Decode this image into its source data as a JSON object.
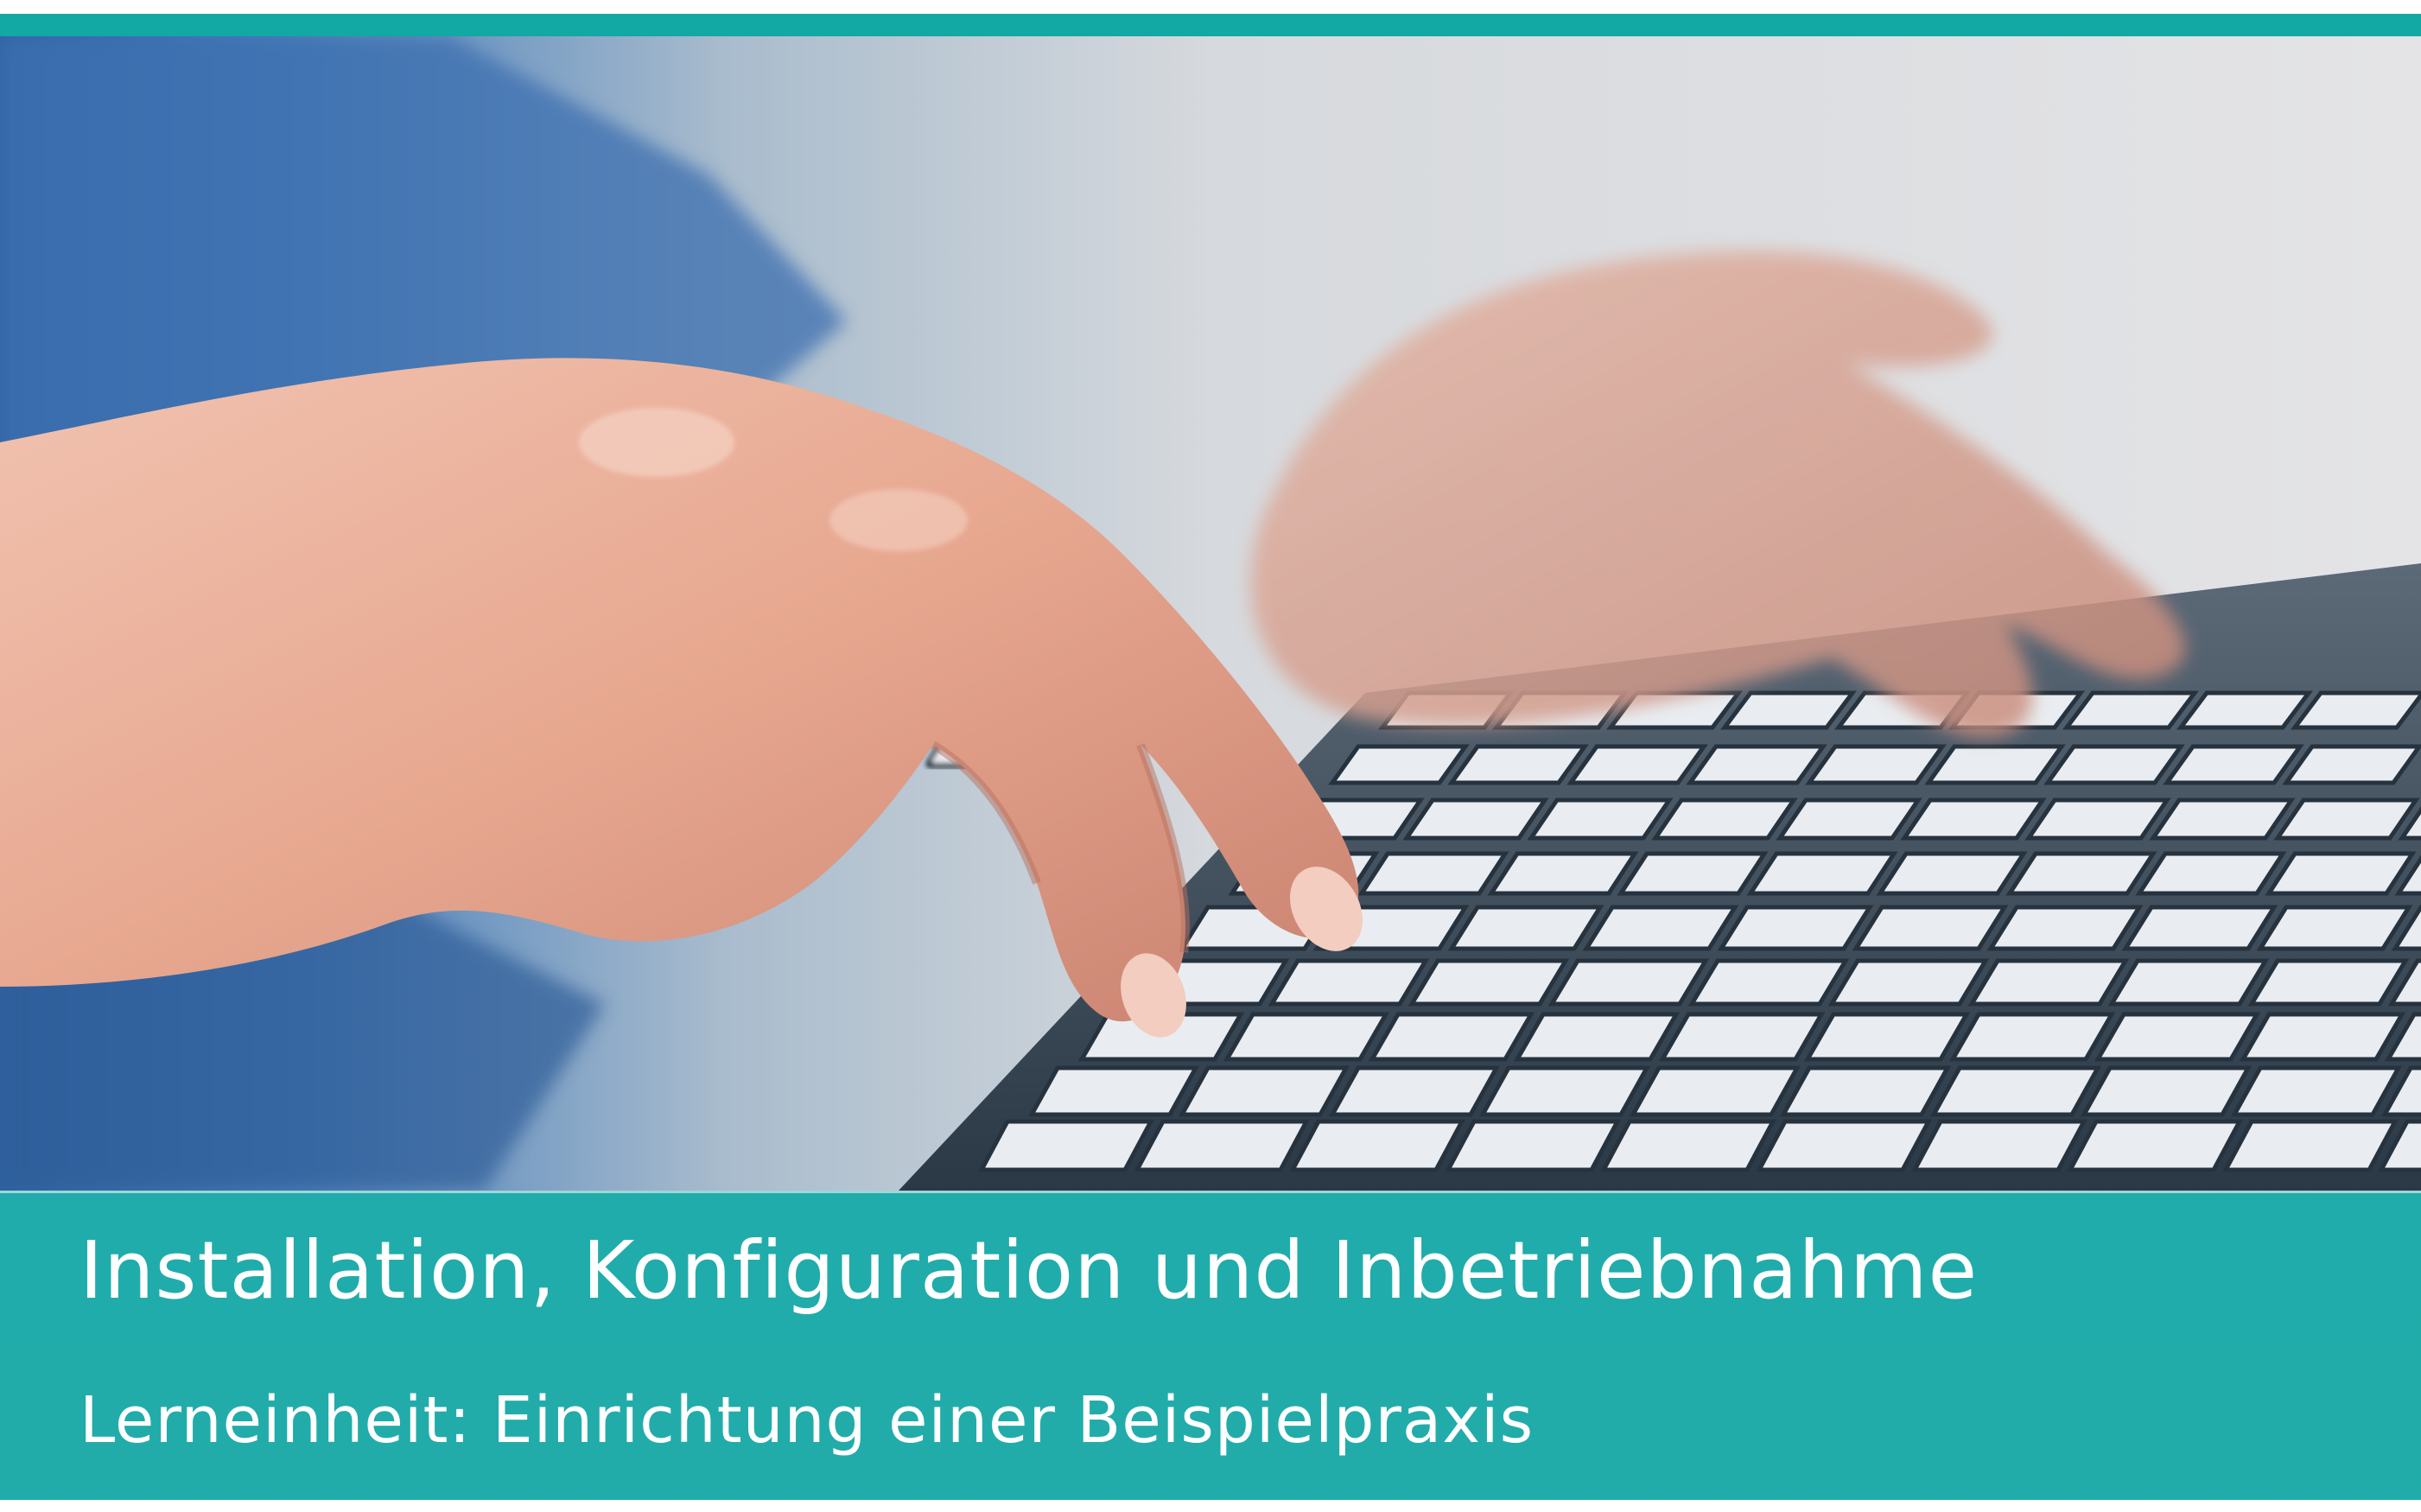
{
  "header": {
    "title": "Installation, Konfiguration und Inbetriebnahme",
    "subtitle": "Lerneinheit: Einrichtung einer Beispielpraxis"
  },
  "colors": {
    "accent": "#12a8a3",
    "band": "#17a8a6",
    "text": "#ffffff"
  },
  "image": {
    "subject": "hands-typing-on-keyboard"
  }
}
